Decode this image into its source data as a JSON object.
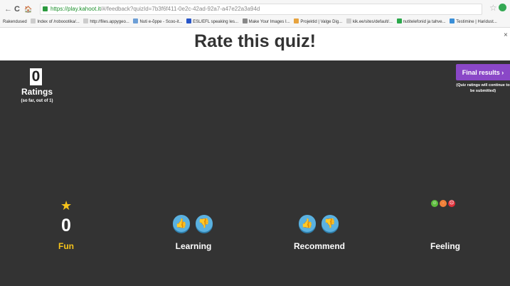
{
  "browser": {
    "url_host": "https://play.kahoot.it",
    "url_rest": "/#/feedback?quizId=7b3f6f411-0e2c-42ad-92a7-a47e22a3a94d",
    "nav": {
      "back": "←",
      "forward": "→",
      "reload": "C",
      "home": "🏠"
    },
    "bookmarks": [
      {
        "label": "Rakendused"
      },
      {
        "label": "Index of /roboootika/..."
      },
      {
        "label": "http://files.appygeo..."
      },
      {
        "label": "Nuti e-õppe - Scoo-it..."
      },
      {
        "label": "ESL/EFL speaking les..."
      },
      {
        "label": "Make Your Images I..."
      },
      {
        "label": "Projektid | Valge Dig..."
      },
      {
        "label": "kik.ee/sites/default/..."
      },
      {
        "label": "nutitelefonid ja tahve..."
      },
      {
        "label": "Testimine | Haridust..."
      }
    ]
  },
  "header": {
    "title": "Rate this quiz!",
    "close": "×"
  },
  "ratings": {
    "count": "0",
    "label": "Ratings",
    "note": "(so far, out of 1)"
  },
  "final": {
    "button": "Final results ›",
    "note": "(Quiz ratings will continue to be submitted)"
  },
  "categories": {
    "fun": {
      "value": "0",
      "label": "Fun",
      "icon": "★"
    },
    "learning": {
      "label": "Learning"
    },
    "recommend": {
      "label": "Recommend"
    },
    "feeling": {
      "label": "Feeling"
    }
  },
  "colors": {
    "accent_purple": "#8a47c7",
    "fun_yellow": "#f6c31b",
    "thumb_blue": "#5ab1e0",
    "face_green": "#5cbc3c",
    "face_orange": "#f0813a",
    "face_red": "#e0303a",
    "panel": "#333333"
  }
}
